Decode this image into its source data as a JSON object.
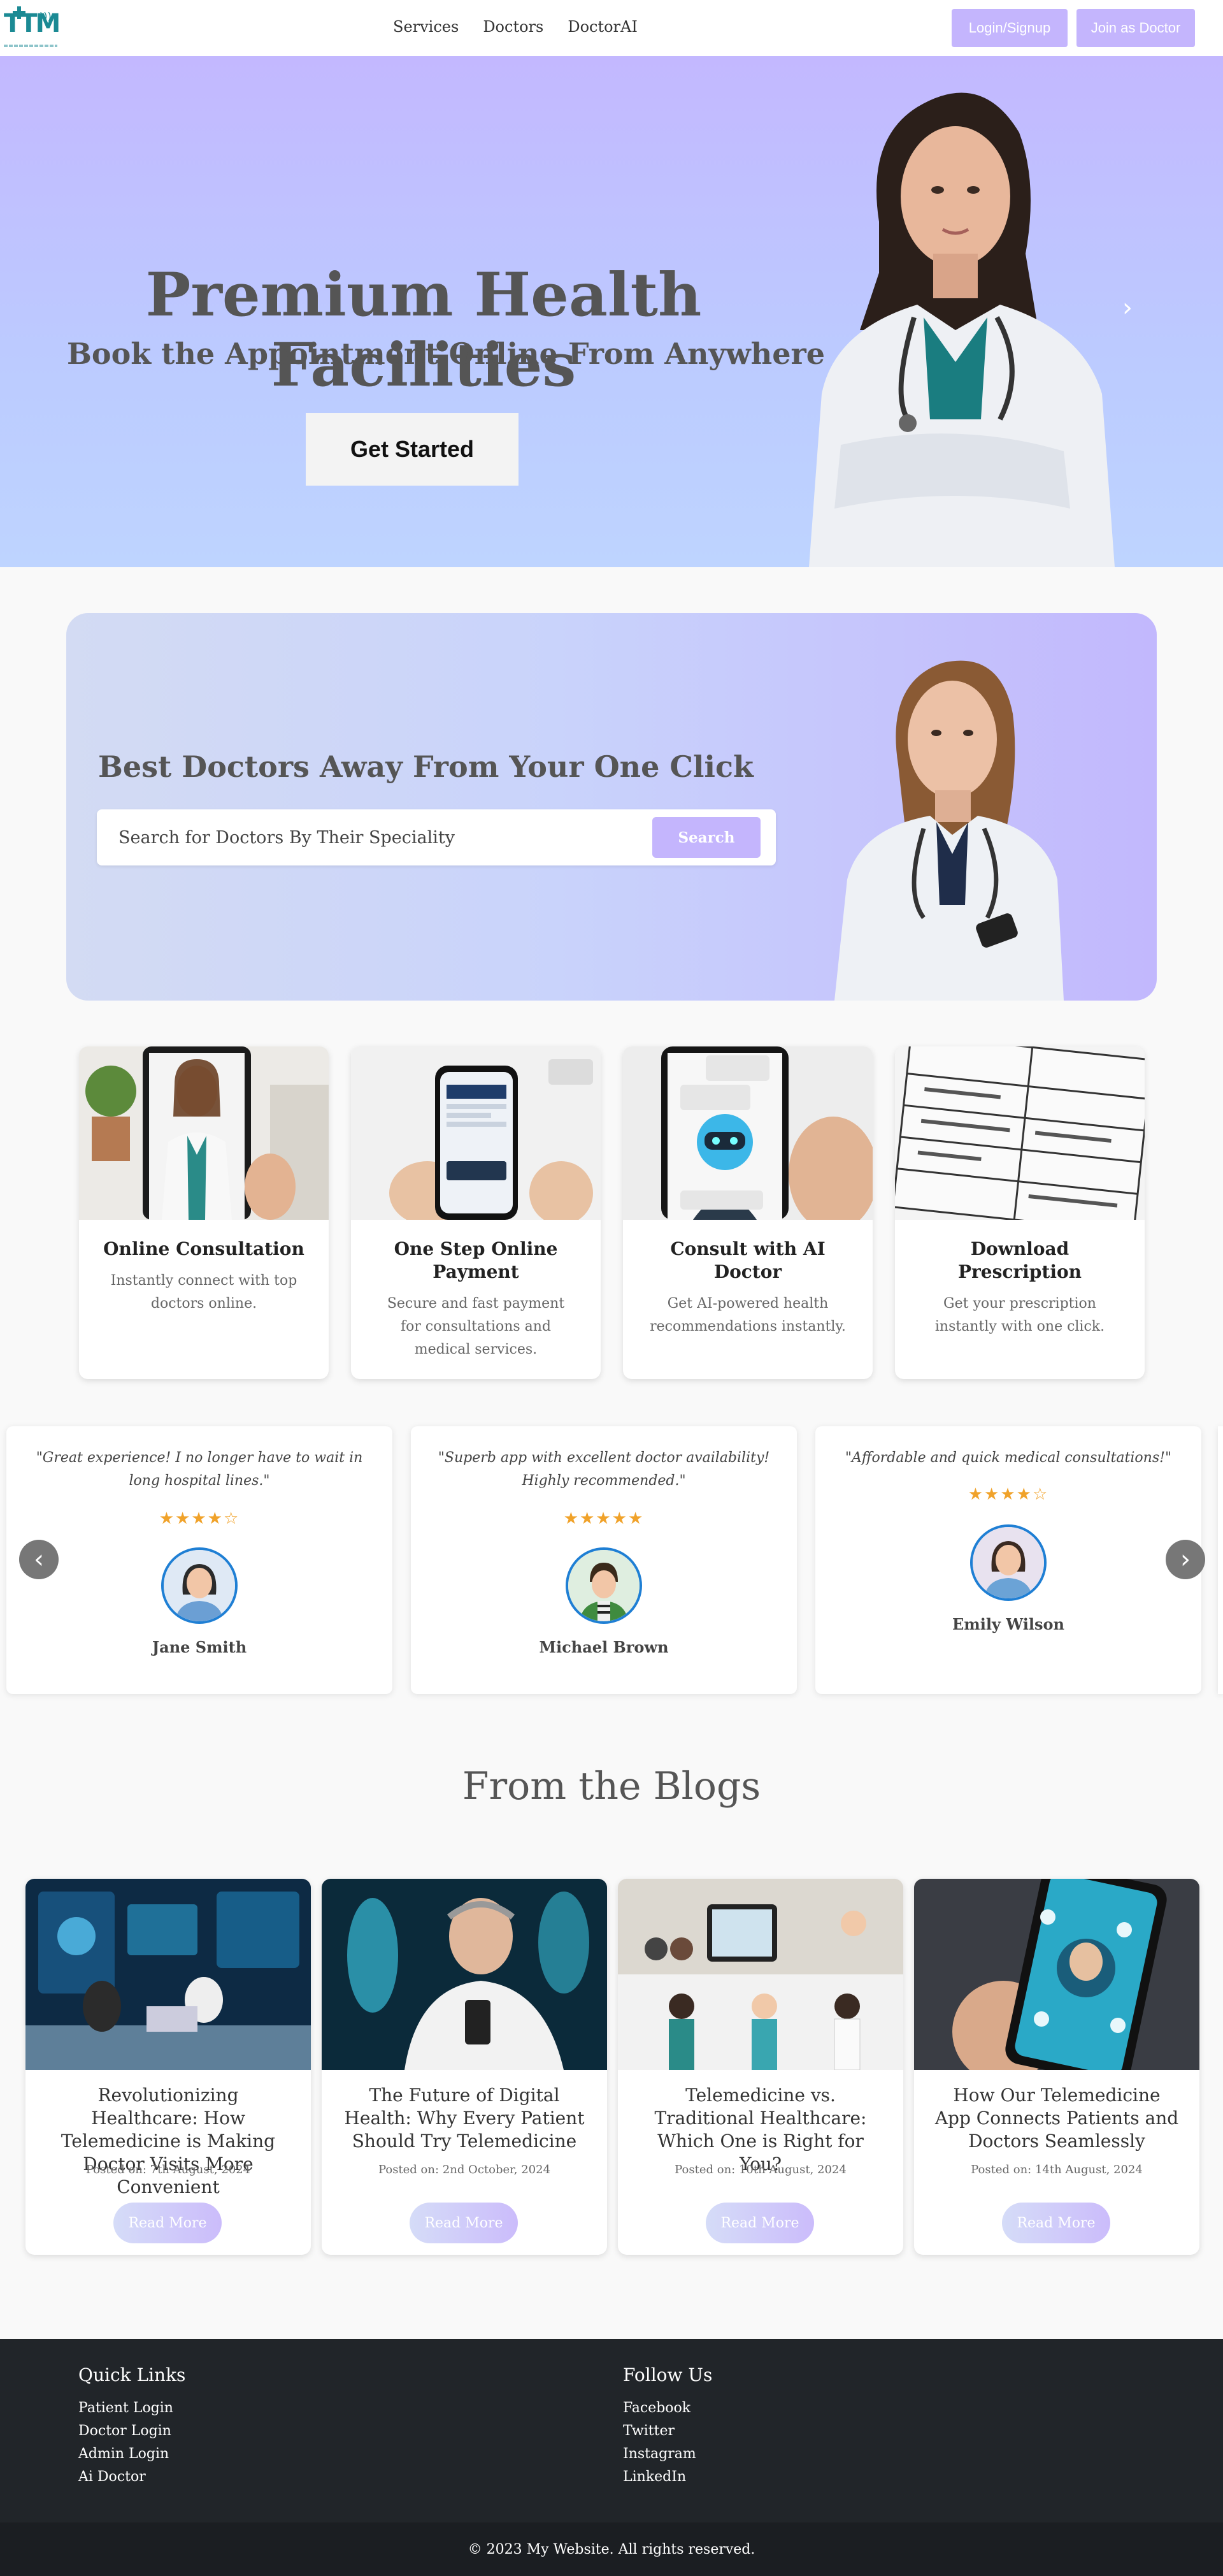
{
  "nav": {
    "links": [
      "Services",
      "Doctors",
      "DoctorAI"
    ],
    "login_label": "Login/Signup",
    "join_label": "Join as Doctor"
  },
  "hero": {
    "title": "Premium Health Facilities",
    "subtitle": "Book the Appointment Online From Anywhere",
    "cta_label": "Get Started",
    "next_arrow": "›"
  },
  "search": {
    "title": "Best Doctors Away From Your One Click",
    "placeholder": "Search for Doctors By Their Speciality",
    "button_label": "Search"
  },
  "services": [
    {
      "title": "Online Consultation",
      "desc": "Instantly connect with top doctors online."
    },
    {
      "title": "One Step Online Payment",
      "desc": "Secure and fast payment for consultations and medical services."
    },
    {
      "title": "Consult with AI Doctor",
      "desc": "Get AI-powered health recommendations instantly."
    },
    {
      "title": "Download Prescription",
      "desc": "Get your prescription instantly with one click."
    }
  ],
  "testimonials": [
    {
      "quote": "\"Great experience! I no longer have to wait in long hospital lines.\"",
      "stars": "★★★★☆",
      "rating": 4,
      "name": "Jane Smith"
    },
    {
      "quote": "\"Superb app with excellent doctor availability! Highly recommended.\"",
      "stars": "★★★★★",
      "rating": 5,
      "name": "Michael Brown"
    },
    {
      "quote": "\"Affordable and quick medical consultations!\"",
      "stars": "★★★★☆",
      "rating": 4,
      "name": "Emily Wilson"
    }
  ],
  "carousel": {
    "prev": "‹",
    "next": "›"
  },
  "blogs": {
    "heading": "From the Blogs",
    "button_label": "Read More",
    "items": [
      {
        "title": "Revolutionizing Healthcare: How Telemedicine is Making Doctor Visits More Convenient",
        "date": "Posted on: 7th August, 2024"
      },
      {
        "title": "The Future of Digital Health: Why Every Patient Should Try Telemedicine",
        "date": "Posted on: 2nd October, 2024"
      },
      {
        "title": "Telemedicine vs. Traditional Healthcare: Which One is Right for You?",
        "date": "Posted on: 10th August, 2024"
      },
      {
        "title": "How Our Telemedicine App Connects Patients and Doctors Seamlessly",
        "date": "Posted on: 14th August, 2024"
      }
    ]
  },
  "footer": {
    "quick_links_title": "Quick Links",
    "quick_links": [
      "Patient Login",
      "Doctor Login",
      "Admin Login",
      "Ai Doctor"
    ],
    "follow_title": "Follow Us",
    "follow_links": [
      "Facebook",
      "Twitter",
      "Instagram",
      "LinkedIn"
    ],
    "copyright": "© 2023 My Website. All rights reserved."
  },
  "colors": {
    "accent": "#c4b5fd",
    "brand": "#1b8a94",
    "star": "#f0a22a",
    "footer_bg": "#212529"
  }
}
